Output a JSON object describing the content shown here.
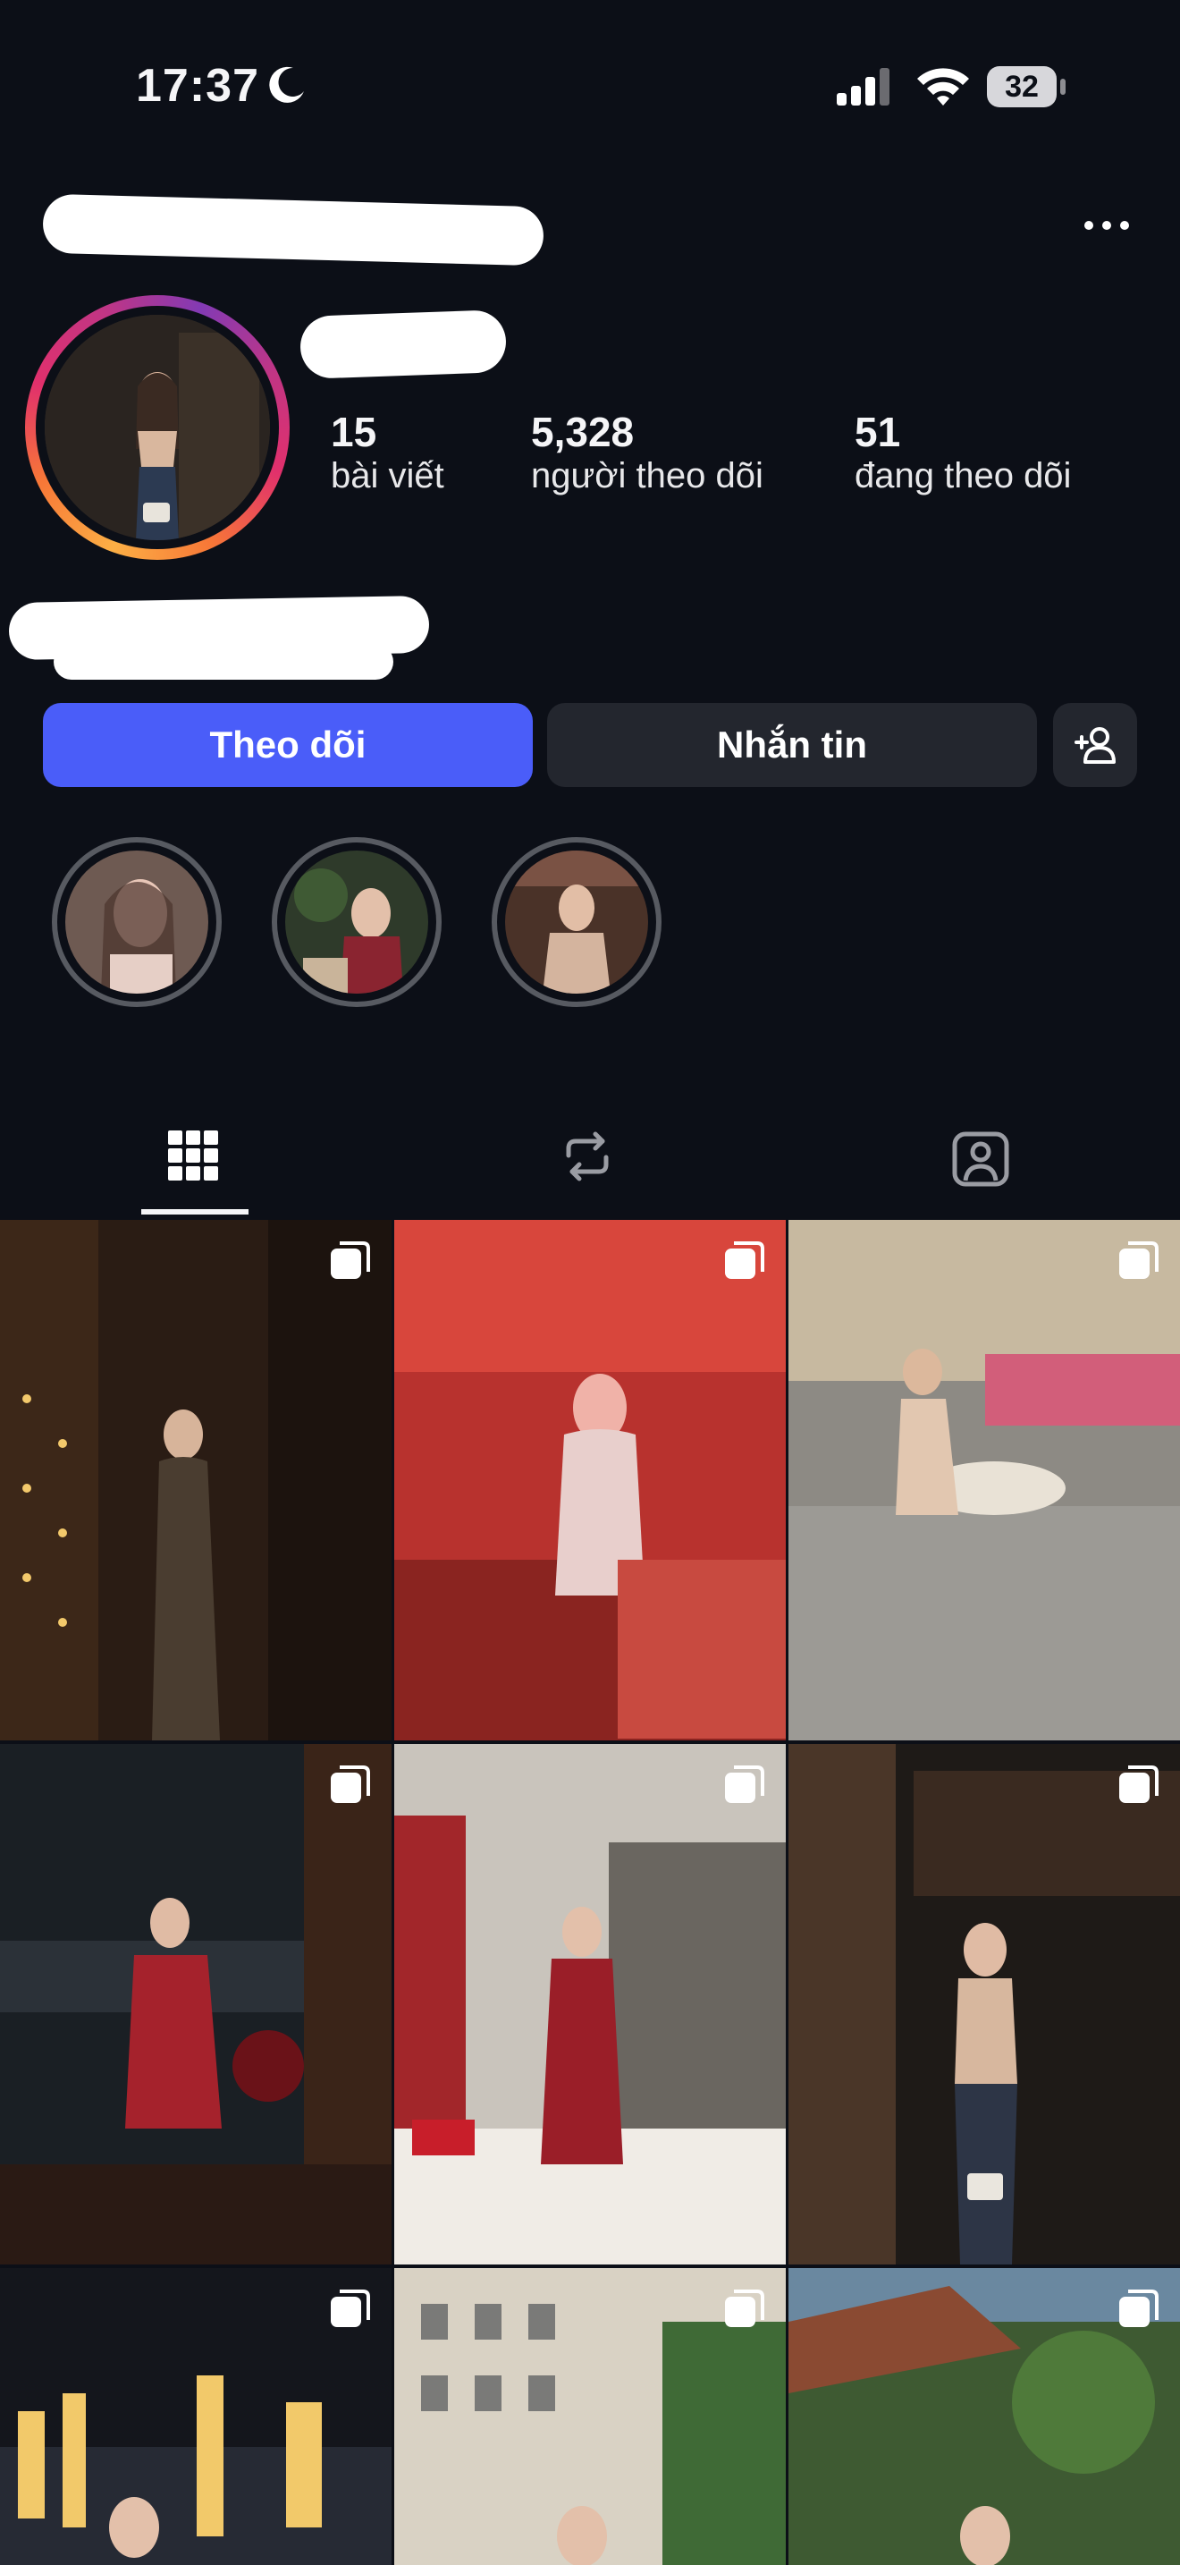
{
  "status_bar": {
    "time": "17:37",
    "battery": "32"
  },
  "profile": {
    "stats": [
      {
        "count": "15",
        "label": "bài viết"
      },
      {
        "count": "5,328",
        "label": "người theo dõi"
      },
      {
        "count": "51",
        "label": "đang theo dõi"
      }
    ]
  },
  "actions": {
    "follow": "Theo dõi",
    "message": "Nhắn tin"
  },
  "icons": {
    "more": "more-horizontal-icon",
    "suggest": "add-person-icon",
    "tab_posts": "grid-icon",
    "tab_reposts": "repost-icon",
    "tab_tagged": "tagged-person-icon",
    "multi": "carousel-icon"
  },
  "colors": {
    "accent": "#4a5df9",
    "background": "#0c0f17",
    "secondary_button": "#23262e"
  }
}
